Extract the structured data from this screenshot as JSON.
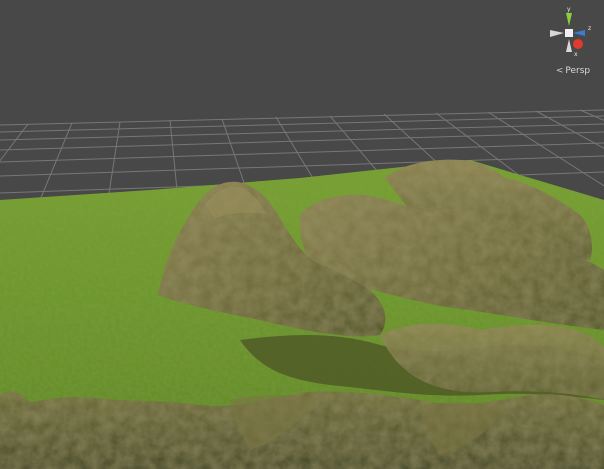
{
  "viewport": {
    "projection_label": "Persp",
    "projection_arrow": "<",
    "background_color": "#484848",
    "grid_color": "#7a7a7a"
  },
  "gizmo": {
    "axis_y_label": "y",
    "axis_z_label": "z",
    "axis_x_label": "x",
    "colors": {
      "x": "#e03a2f",
      "y": "#8bcf3a",
      "z": "#3a7bd5",
      "neutral": "#d8d8d8"
    }
  },
  "terrain": {
    "grass_color": "#6f9a2c",
    "rock_color": "#7d7345",
    "icons": [
      "terrain-mesh",
      "scene-grid",
      "orientation-gizmo"
    ]
  }
}
